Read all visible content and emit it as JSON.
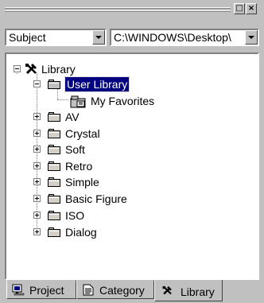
{
  "titlebar": {
    "restore_glyph": "□",
    "close_glyph": "×"
  },
  "filters": {
    "sort_value": "Subject",
    "path_value": "C:\\WINDOWS\\Desktop\\"
  },
  "tree": {
    "root": "Library",
    "user_library": "User Library",
    "favorites": "My Favorites",
    "folders": [
      "AV",
      "Crystal",
      "Soft",
      "Retro",
      "Simple",
      "Basic Figure",
      "ISO",
      "Dialog"
    ]
  },
  "tabs": {
    "project": "Project",
    "category": "Category",
    "library": "Library",
    "active": "Library"
  }
}
